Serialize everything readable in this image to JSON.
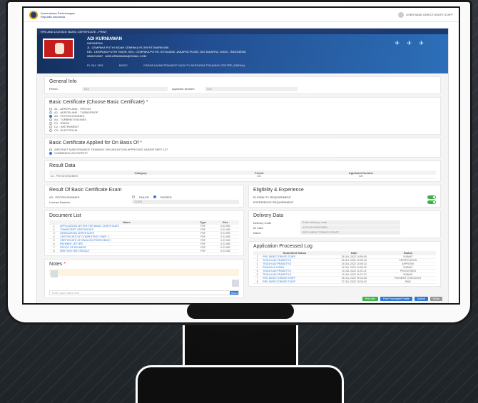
{
  "app": {
    "brand_line1": "Kementerian Perhubungan",
    "brand_line2": "Republik Indonesia",
    "user_label": "USER BASE DIRECTORATE STAFF"
  },
  "modal_title": "RPD AND LICENCE: BASIC CERTIFICATE - PRINT",
  "hero": {
    "name": "ADI KURNIAWAN",
    "line1": "INDONESIA",
    "line2": "JL. CEMPAKA PUTIH INDAH CEMPAKA PUTIH RT.004/RW.006",
    "line3": "KEL. CEMPAKA PUTIH TIMUR, KEC. CEMPAKA PUTIH, KOTA ADM. JAKARTA PUSAT, DKI JAKARTA, 10510 - INDONESIA",
    "phone": "0881234567",
    "email": "ADIKURNIAWAN@GMAIL.COM",
    "foot1": "PL 2A1 1301",
    "foot2": "BASIC",
    "foot3": "GARUDA MAINTENANCE FACILITY AEROASIA TRAINING CENTRE (GMFAA)"
  },
  "general": {
    "title": "General Info",
    "period_label": "Period",
    "period_value": "I/22",
    "applicant_label": "Applicant Number",
    "applicant_value": "I/22"
  },
  "basic": {
    "title": "Basic Certificate (Choose Basic Certificate)",
    "options": [
      {
        "label": "A1 - AEROPLANE - PISTON",
        "on": false
      },
      {
        "label": "A2 - AEROPLANE - TURBOPROP",
        "on": false
      },
      {
        "label": "A3 - PISTON ENGINES",
        "on": true
      },
      {
        "label": "A4 - TURBINE ENGINES",
        "on": false
      },
      {
        "label": "C1 - RADIO",
        "on": false
      },
      {
        "label": "C2 - INSTRUMENT",
        "on": false
      },
      {
        "label": "C3 - ELECTRICAL",
        "on": false
      }
    ]
  },
  "basis": {
    "title": "Basic Certificate Applied for On Basis Of",
    "options": [
      {
        "label": "AIRCRAFT MAINTENANCE TRAINING ORGANIZATION APPROVED UNDER PART 147",
        "on": false
      },
      {
        "label": "COMBINING AUTHORITY",
        "on": true
      }
    ]
  },
  "result": {
    "title": "Result Data",
    "headers": [
      "Category",
      "Period",
      "Applicant Number"
    ],
    "row": [
      "A3 - PISTON ENGINES",
      "I/22",
      "I/22"
    ]
  },
  "exam": {
    "title": "Result Of Basic Certificate Exam",
    "cert_label": "A3 - PISTON ENGINES",
    "failed": "FAILED",
    "passed": "PASSED",
    "licence_label": "License Number",
    "licence_value": "11308"
  },
  "eligibility": {
    "title": "Eligibility & Experience",
    "items": [
      "ELIGIBILITY REQUIREMENT",
      "EXPERIENCE REQUIREMENT"
    ]
  },
  "delivery": {
    "title": "Delivery Data",
    "rows": [
      {
        "label": "Delivery Code",
        "value": "Enter delivery code"
      },
      {
        "label": "ID Card",
        "value": "1471012345678901"
      },
      {
        "label": "Name",
        "value": "RPD DIRECTORATE STAFF"
      }
    ]
  },
  "documents": {
    "title": "Document List",
    "headers": [
      "",
      "Name",
      "Type",
      "Size"
    ],
    "rows": [
      [
        "1",
        "APPLICATION LETTER FOR BASIC CERTIFICATE",
        "PDF",
        "0.22 MB"
      ],
      [
        "2",
        "TRANSCRIPT CERTIFICATE",
        "PDF",
        "0.22 MB"
      ],
      [
        "3",
        "GRADUATION CERTIFICATE",
        "PDF",
        "0.22 MB"
      ],
      [
        "4",
        "CERTIFICATE OF COMPETENCY PART 1",
        "PDF",
        "0.22 MB"
      ],
      [
        "5",
        "CERTIFICATE OF ENGLISH PROFICIENCY",
        "PDF",
        "0.22 MB"
      ],
      [
        "6",
        "PAYMENT LETTER",
        "PDF",
        "0.22 MB"
      ],
      [
        "7",
        "PROOF OF PAYMENT",
        "PDF",
        "0.22 MB"
      ],
      [
        "8",
        "WRITTEN TEST RESULT",
        "PDF",
        "0.22 MB"
      ]
    ]
  },
  "log": {
    "title": "Application Processed Log",
    "headers": [
      "",
      "Submitted Status",
      "Date",
      "Status"
    ],
    "rows": [
      [
        "1",
        "RPD DIRECTORATE STAFF",
        "28 JUL 2022 10:55:05",
        "SUBMIT"
      ],
      [
        "2",
        "TEGUH ADI PRASETYO",
        "28 JUL 2022 10:55:45",
        "VERIFICATION"
      ],
      [
        "3",
        "TEGUH ADI PRASETYO",
        "15 JUL 2022 10:55:23",
        "APPROVE"
      ],
      [
        "4",
        "RIZZAHUL AJSAN",
        "15 JUL 2022 10:55:30",
        "SUBMIT"
      ],
      [
        "5",
        "TEGUH ADI PRASETYO",
        "15 JUL 2022 11:01:11",
        "PROCESSED"
      ],
      [
        "6",
        "TEGUH ADI PRASETYO",
        "15 JUL 2022 11:07:23",
        "SUBMIT"
      ],
      [
        "7",
        "RPD DIRECTORATE STAFF",
        "26 JUL 2022 09:18:08",
        "PAYMENT CHECKOUT"
      ],
      [
        "8",
        "RPD DIRECTORATE STAFF",
        "27 JUL 2022 15:30:02",
        "PAID"
      ]
    ]
  },
  "notes": {
    "title": "Notes",
    "placeholder": "Enter your notes here",
    "send": "Send"
  },
  "footer": {
    "btn1": "Print Info",
    "btn2": "Print Processed Profile",
    "btn3": "Submit",
    "btn4": "Close"
  },
  "colors": {
    "accent": "#2b78d5",
    "header": "#1d3a70",
    "success": "#3cb34a"
  }
}
